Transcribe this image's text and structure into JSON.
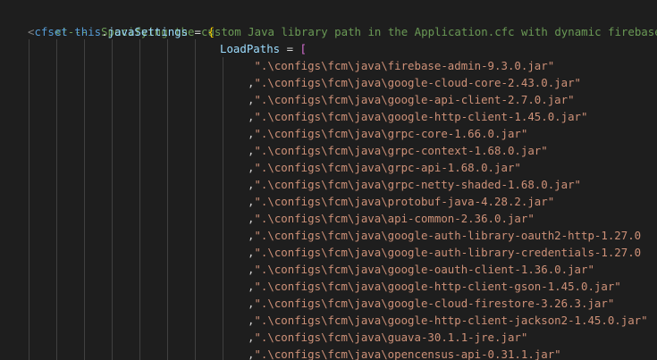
{
  "editor": {
    "comment_text": "<!---  Specifying the custom Java library path in the Application.cfc with dynamic firebase",
    "cfset_open": "<",
    "cfset_tag": "cfset",
    "this_keyword": "this",
    "dot": ".",
    "settings_name": "javaSettings",
    "assign": " = ",
    "open_brace": "{",
    "loadpaths_key": "LoadPaths",
    "loadpaths_assign": " = ",
    "open_bracket": "[",
    "paths": [
      "\".\\configs\\fcm\\java\\firebase-admin-9.3.0.jar\"",
      "\".\\configs\\fcm\\java\\google-cloud-core-2.43.0.jar\"",
      "\".\\configs\\fcm\\java\\google-api-client-2.7.0.jar\"",
      "\".\\configs\\fcm\\java\\google-http-client-1.45.0.jar\"",
      "\".\\configs\\fcm\\java\\grpc-core-1.66.0.jar\"",
      "\".\\configs\\fcm\\java\\grpc-context-1.68.0.jar\"",
      "\".\\configs\\fcm\\java\\grpc-api-1.68.0.jar\"",
      "\".\\configs\\fcm\\java\\grpc-netty-shaded-1.68.0.jar\"",
      "\".\\configs\\fcm\\java\\protobuf-java-4.28.2.jar\"",
      "\".\\configs\\fcm\\java\\api-common-2.36.0.jar\"",
      "\".\\configs\\fcm\\java\\google-auth-library-oauth2-http-1.27.0",
      "\".\\configs\\fcm\\java\\google-auth-library-credentials-1.27.0",
      "\".\\configs\\fcm\\java\\google-oauth-client-1.36.0.jar\"",
      "\".\\configs\\fcm\\java\\google-http-client-gson-1.45.0.jar\"",
      "\".\\configs\\fcm\\java\\google-cloud-firestore-3.26.3.jar\"",
      "\".\\configs\\fcm\\java\\google-http-client-jackson2-1.45.0.jar\"",
      "\".\\configs\\fcm\\java\\guava-30.1.1-jre.jar\"",
      "\".\\configs\\fcm\\java\\opencensus-api-0.31.1.jar\""
    ],
    "comma": ","
  },
  "colors": {
    "background": "#1e1e1e",
    "comment": "#6a9955",
    "keyword": "#569cd6",
    "property": "#9cdcfe",
    "string": "#ce9178",
    "brace": "#ffd700",
    "bracket": "#da70d6"
  }
}
